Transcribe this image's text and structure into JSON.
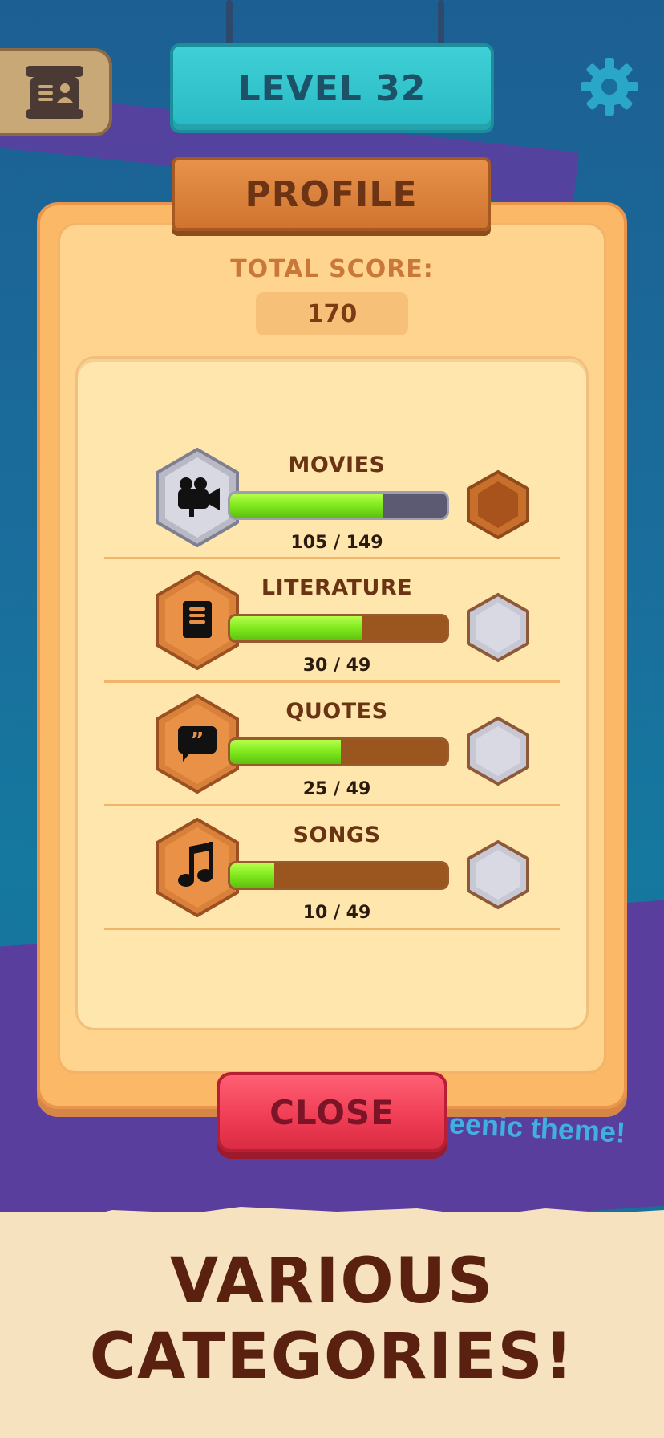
{
  "header": {
    "level_label": "LEVEL 32"
  },
  "panel": {
    "title": "PROFILE",
    "score_label": "TOTAL SCORE:",
    "score_value": "170",
    "categories": [
      {
        "name": "MOVIES",
        "count": "105 / 149",
        "progress": 0.705,
        "icon": "movie-camera-icon",
        "tier": "silver",
        "next_badge": "bronze-badge"
      },
      {
        "name": "LITERATURE",
        "count": "30 / 49",
        "progress": 0.612,
        "icon": "book-icon",
        "tier": "bronze",
        "next_badge": "silver-badge"
      },
      {
        "name": "QUOTES",
        "count": "25 / 49",
        "progress": 0.51,
        "icon": "quote-bubble-icon",
        "tier": "bronze",
        "next_badge": "silver-badge"
      },
      {
        "name": "SONGS",
        "count": "10 / 49",
        "progress": 0.204,
        "icon": "music-note-icon",
        "tier": "bronze",
        "next_badge": "silver-badge"
      }
    ],
    "close_label": "CLOSE"
  },
  "background_text": "eenic theme!",
  "banner": {
    "line1": "VARIOUS",
    "line2": "CATEGORIES!"
  },
  "colors": {
    "background": "#1a6e9c",
    "panel": "#fbb866",
    "panel_inner": "#ffe6ad",
    "progress_green": "#7fe81d",
    "close_red": "#ee3c53",
    "level_teal": "#3fd0d6",
    "wood": "#cf7430",
    "title_text": "#6a3414"
  }
}
